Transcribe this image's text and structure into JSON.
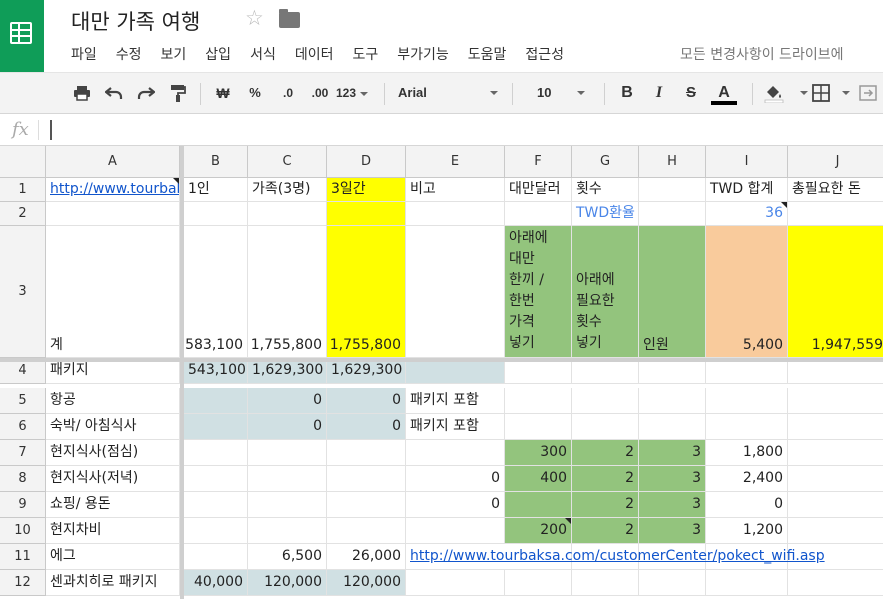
{
  "doc": {
    "title": "대만 가족 여행",
    "save_status": "모든 변경사항이 드라이브에"
  },
  "menu": [
    "파일",
    "수정",
    "보기",
    "삽입",
    "서식",
    "데이터",
    "도구",
    "부가기능",
    "도움말",
    "접근성"
  ],
  "toolbar": {
    "currency": "₩",
    "percent": "%",
    "dec_decrease": ".0",
    "dec_increase": ".00",
    "more_formats": "123",
    "font": "Arial",
    "font_size": "10",
    "bold": "B",
    "italic": "I",
    "strike": "S",
    "text_color": "A",
    "text_color_hex": "#000000"
  },
  "formula": {
    "icon": "fx",
    "value": ""
  },
  "columns": [
    "A",
    "B",
    "C",
    "D",
    "E",
    "F",
    "G",
    "H",
    "I",
    "J"
  ],
  "rows": [
    "1",
    "2",
    "3",
    "4",
    "5",
    "6",
    "7",
    "8",
    "9",
    "10",
    "11",
    "12"
  ],
  "colors": {
    "yellow": "#ffff00",
    "green": "#93c47d",
    "peach": "#f9cb9c",
    "bluegray": "#d0e0e3",
    "link": "#1155cc",
    "brand": "#0f9d58"
  },
  "cells": {
    "A1": "http://www.tourbaksa.com",
    "B1": "1인",
    "C1": "가족(3명)",
    "D1": "3일간",
    "E1": "비고",
    "F1": "대만달러",
    "G1": "횟수",
    "I1": "TWD 합계",
    "J1": "총필요한 돈",
    "G2": "TWD환율",
    "I2": "36",
    "A3": "계",
    "B3": "583,100",
    "C3": "1,755,800",
    "D3": "1,755,800",
    "F3": "아래에\n대만\n한끼 /\n한번\n가격\n넣기",
    "G3": "아래에\n필요한\n횟수\n넣기",
    "H3": "인원",
    "I3": "5,400",
    "J3": "1,947,559",
    "A4": "패키지",
    "B4": "543,100",
    "C4": "1,629,300",
    "D4": "1,629,300",
    "A5": "항공",
    "C5": "0",
    "D5": "0",
    "E5": "패키지 포함",
    "A6": "숙박/ 아침식사",
    "C6": "0",
    "D6": "0",
    "E6": "패키지 포함",
    "A7": "현지식사(점심)",
    "F7": "300",
    "G7": "2",
    "H7": "3",
    "I7": "1,800",
    "A8": "현지식사(저녁)",
    "E8": "0",
    "F8": "400",
    "G8": "2",
    "H8": "3",
    "I8": "2,400",
    "A9": "쇼핑/ 용돈",
    "E9": "0",
    "G9": "2",
    "H9": "3",
    "I9": "0",
    "A10": "현지차비",
    "F10": "200",
    "G10": "2",
    "H10": "3",
    "I10": "1,200",
    "A11": "에그",
    "C11": "6,500",
    "D11": "26,000",
    "E11": "http://www.tourbaksa.com/customerCenter/pokect_wifi.asp",
    "A12": "센과치히로 패키지",
    "B12": "40,000",
    "C12": "120,000",
    "D12": "120,000"
  }
}
